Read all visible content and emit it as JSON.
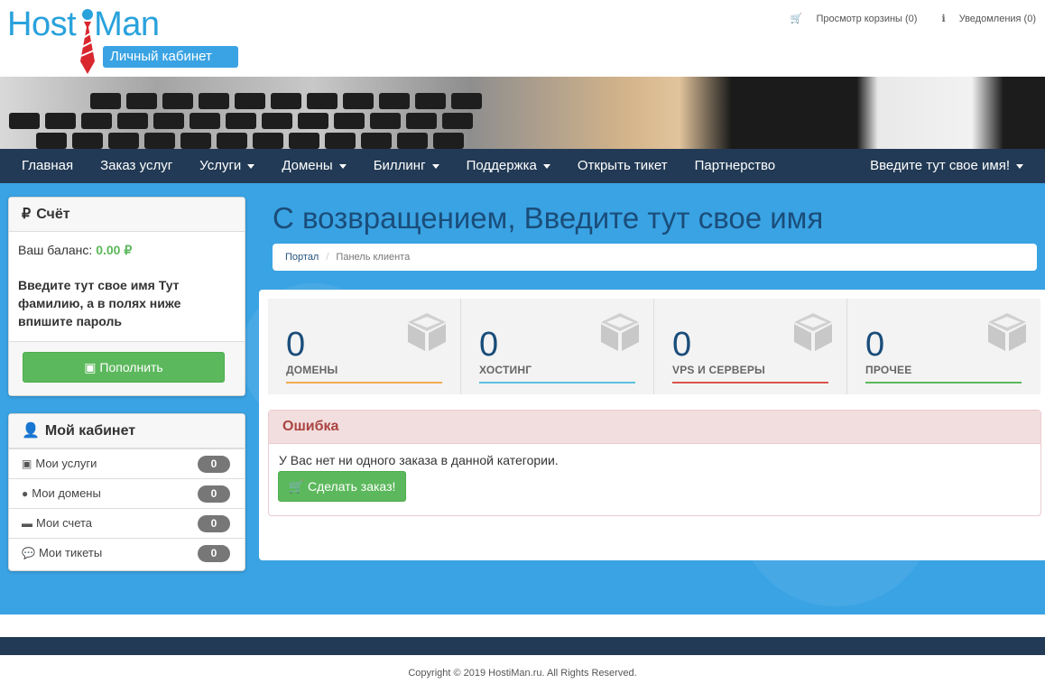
{
  "header": {
    "logo_text_a": "Host",
    "logo_text_b": "Man",
    "cabinet_label": "Личный кабинет",
    "cart_link": "Просмотр корзины (0)",
    "notifications_link": "Уведомления (0)"
  },
  "nav": {
    "items": [
      {
        "label": "Главная"
      },
      {
        "label": "Заказ услуг"
      },
      {
        "label": "Услуги"
      },
      {
        "label": "Домены"
      },
      {
        "label": "Биллинг"
      },
      {
        "label": "Поддержка"
      },
      {
        "label": "Открыть тикет"
      },
      {
        "label": "Партнерство"
      }
    ],
    "user_menu": "Введите тут свое имя!"
  },
  "account_panel": {
    "title": "Счёт",
    "currency_icon": "₽",
    "balance_label": "Ваш баланс:",
    "balance_value": "0.00 ₽",
    "notice": "Введите тут свое имя Тут фамилию, а в полях ниже впишите пароль",
    "topup_button": "Пополнить"
  },
  "cabinet_panel": {
    "title": "Мой кабинет",
    "items": [
      {
        "label": "Мои услуги",
        "count": "0"
      },
      {
        "label": "Мои домены",
        "count": "0"
      },
      {
        "label": "Мои счета",
        "count": "0"
      },
      {
        "label": "Мои тикеты",
        "count": "0"
      }
    ]
  },
  "main": {
    "title": "С возвращением, Введите тут свое имя",
    "breadcrumb": {
      "home": "Портал",
      "current": "Панель клиента"
    },
    "stats": [
      {
        "value": "0",
        "label": "ДОМЕНЫ",
        "color": "#f0ad4e"
      },
      {
        "value": "0",
        "label": "ХОСТИНГ",
        "color": "#5bc0de"
      },
      {
        "value": "0",
        "label": "VPS И СЕРВЕРЫ",
        "color": "#d9534f"
      },
      {
        "value": "0",
        "label": "ПРОЧЕЕ",
        "color": "#5cb85c"
      }
    ],
    "alert": {
      "title": "Ошибка",
      "text": "У Вас нет ни одного заказа в данной категории.",
      "button": "Сделать заказ!"
    }
  },
  "footer": {
    "copyright": "Copyright © 2019 HostiMan.ru. All Rights Reserved."
  }
}
